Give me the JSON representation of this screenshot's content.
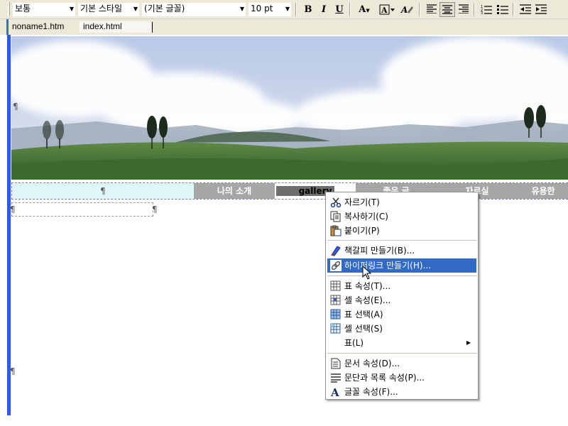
{
  "toolbar": {
    "paragraph_style": "보통",
    "base_style": "기본 스타일",
    "font": "(기본 글꼴)",
    "size": "10 pt",
    "bold": "B",
    "italic": "I",
    "underline": "U",
    "font_color": "A"
  },
  "tabs": [
    {
      "label": "noname1.htm"
    },
    {
      "label": "index.html"
    }
  ],
  "editor": {
    "pilcrow": "¶",
    "nav": [
      "나의 소개",
      "gallery",
      "좋은 글",
      "자료실",
      "유용한"
    ]
  },
  "context_menu": {
    "items": [
      {
        "label": "자르기(T)",
        "icon": "scissors-icon"
      },
      {
        "label": "복사하기(C)",
        "icon": "copy-icon"
      },
      {
        "label": "붙이기(P)",
        "icon": "paste-icon"
      },
      {
        "label": "책갈피 만들기(B)...",
        "icon": "bookmark-icon"
      },
      {
        "label": "하이퍼링크 만들기(H)...",
        "icon": "hyperlink-icon",
        "highlighted": true
      },
      {
        "label": "표 속성(T)...",
        "icon": "table-properties-icon"
      },
      {
        "label": "셀 속성(E)...",
        "icon": "cell-properties-icon"
      },
      {
        "label": "표 선택(A)",
        "icon": "select-table-icon"
      },
      {
        "label": "셀 선택(S)",
        "icon": "select-cell-icon"
      },
      {
        "label": "표(L)",
        "icon": "",
        "submenu": true
      },
      {
        "label": "문서 속성(D)...",
        "icon": "document-properties-icon"
      },
      {
        "label": "문단과 목록 속성(P)...",
        "icon": "paragraph-properties-icon"
      },
      {
        "label": "글꼴 속성(F)...",
        "icon": "font-properties-icon"
      }
    ],
    "highlight_color": "#316ac5"
  }
}
